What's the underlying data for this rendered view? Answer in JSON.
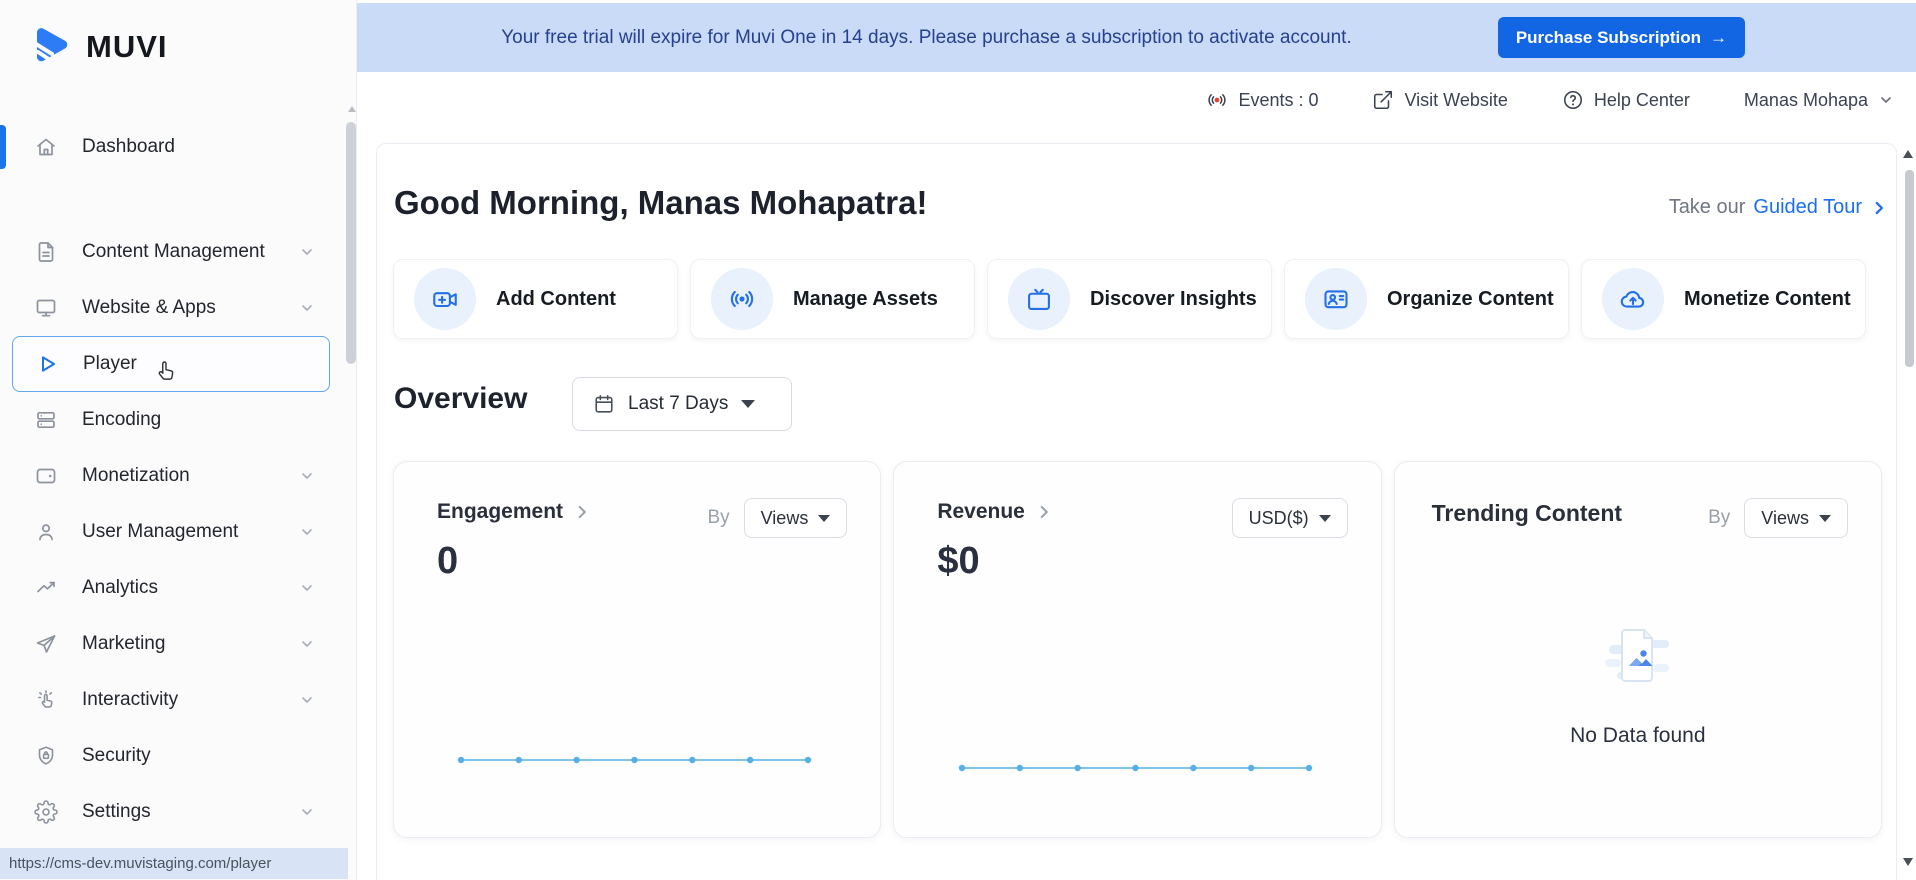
{
  "colors": {
    "accent_blue": "#1a73e8",
    "banner_bg": "#c9dbf7",
    "banner_text": "#27408f",
    "button_bg": "#1266e3",
    "chart_line": "#55b0e3",
    "icon_circle_bg": "#e8f1fc"
  },
  "sidebar": {
    "logo_text": "MUVI",
    "items": [
      {
        "label": "Dashboard",
        "icon": "home-icon",
        "active": true,
        "has_chevron": false
      },
      {
        "label": "Content Management",
        "icon": "file-text-icon",
        "has_chevron": true
      },
      {
        "label": "Website & Apps",
        "icon": "monitor-icon",
        "has_chevron": true
      },
      {
        "label": "Player",
        "icon": "play-icon",
        "highlighted": true,
        "has_chevron": false
      },
      {
        "label": "Encoding",
        "icon": "server-icon",
        "has_chevron": false
      },
      {
        "label": "Monetization",
        "icon": "wallet-icon",
        "has_chevron": true
      },
      {
        "label": "User Management",
        "icon": "user-icon",
        "has_chevron": true
      },
      {
        "label": "Analytics",
        "icon": "trending-up-icon",
        "has_chevron": true
      },
      {
        "label": "Marketing",
        "icon": "send-icon",
        "has_chevron": true
      },
      {
        "label": "Interactivity",
        "icon": "tap-icon",
        "has_chevron": true
      },
      {
        "label": "Security",
        "icon": "shield-lock-icon",
        "has_chevron": false
      },
      {
        "label": "Settings",
        "icon": "gear-icon",
        "has_chevron": true
      }
    ],
    "status_url": "https://cms-dev.muvistaging.com/player"
  },
  "banner": {
    "message": "Your free trial will expire for Muvi One in 14 days. Please purchase a subscription to activate account.",
    "cta_label": "Purchase Subscription",
    "cta_arrow": "→"
  },
  "header": {
    "events_label": "Events : 0",
    "visit_website_label": "Visit Website",
    "help_center_label": "Help Center",
    "user_name": "Manas Mohapa"
  },
  "main": {
    "greeting": "Good Morning, Manas Mohapatra!",
    "guided_tour": {
      "prefix": "Take our",
      "link_label": "Guided Tour"
    },
    "quick_actions": [
      {
        "label": "Add Content",
        "icon": "video-plus-icon"
      },
      {
        "label": "Manage Assets",
        "icon": "broadcast-icon"
      },
      {
        "label": "Discover Insights",
        "icon": "tv-icon"
      },
      {
        "label": "Organize Content",
        "icon": "user-card-icon"
      },
      {
        "label": "Monetize Content",
        "icon": "cloud-dollar-icon"
      }
    ],
    "overview": {
      "title": "Overview",
      "date_filter_value": "Last 7 Days"
    },
    "engagement_card": {
      "title": "Engagement",
      "by_label": "By",
      "select_value": "Views",
      "value": "0"
    },
    "revenue_card": {
      "title": "Revenue",
      "select_value": "USD($)",
      "value": "$0"
    },
    "trending_card": {
      "title": "Trending Content",
      "by_label": "By",
      "select_value": "Views",
      "empty_text": "No Data found"
    }
  },
  "chart_data": [
    {
      "type": "line",
      "name": "Engagement by Views (Last 7 Days)",
      "x": [
        1,
        2,
        3,
        4,
        5,
        6,
        7
      ],
      "values": [
        0,
        0,
        0,
        0,
        0,
        0,
        0
      ],
      "color": "#55b0e3",
      "title": "",
      "xlabel": "",
      "ylabel": "",
      "axes_visible": false,
      "grid": false,
      "legend": "none",
      "note": "flat zero line with 7 dot markers near card bottom"
    },
    {
      "type": "line",
      "name": "Revenue USD($) (Last 7 Days)",
      "x": [
        1,
        2,
        3,
        4,
        5,
        6,
        7
      ],
      "values": [
        0,
        0,
        0,
        0,
        0,
        0,
        0
      ],
      "color": "#55b0e3",
      "title": "",
      "xlabel": "",
      "ylabel": "",
      "axes_visible": false,
      "grid": false,
      "legend": "none",
      "note": "flat zero line with 7 dot markers near card bottom"
    }
  ]
}
